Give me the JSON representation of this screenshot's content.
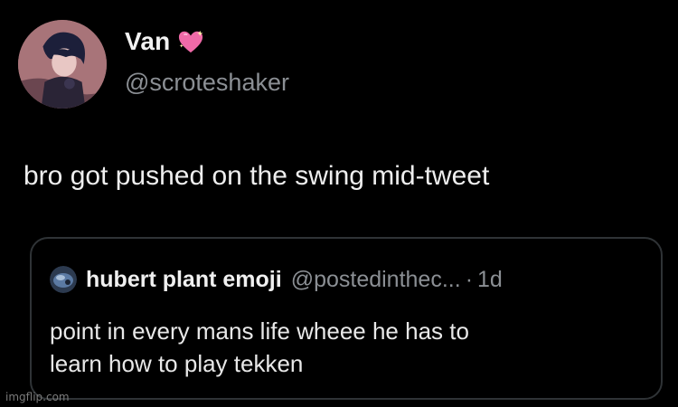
{
  "tweet": {
    "author": {
      "display_name": "Van",
      "name_emoji": "sparkling-heart-icon",
      "handle": "@scroteshaker"
    },
    "text": "bro got pushed on the swing mid-tweet",
    "quote": {
      "author_name": "hubert plant emoji",
      "handle": "@postedinthec...",
      "separator": "·",
      "time": "1d",
      "text_lines": [
        "point in every mans life wheee he has to",
        "learn how to play tekken"
      ]
    }
  },
  "watermark": "imgflip.com",
  "colors": {
    "background": "#000000",
    "primary_text": "#e7e9ea",
    "secondary_text": "#8b8f94",
    "border": "#2f3336",
    "heart": "#f06aa8"
  }
}
